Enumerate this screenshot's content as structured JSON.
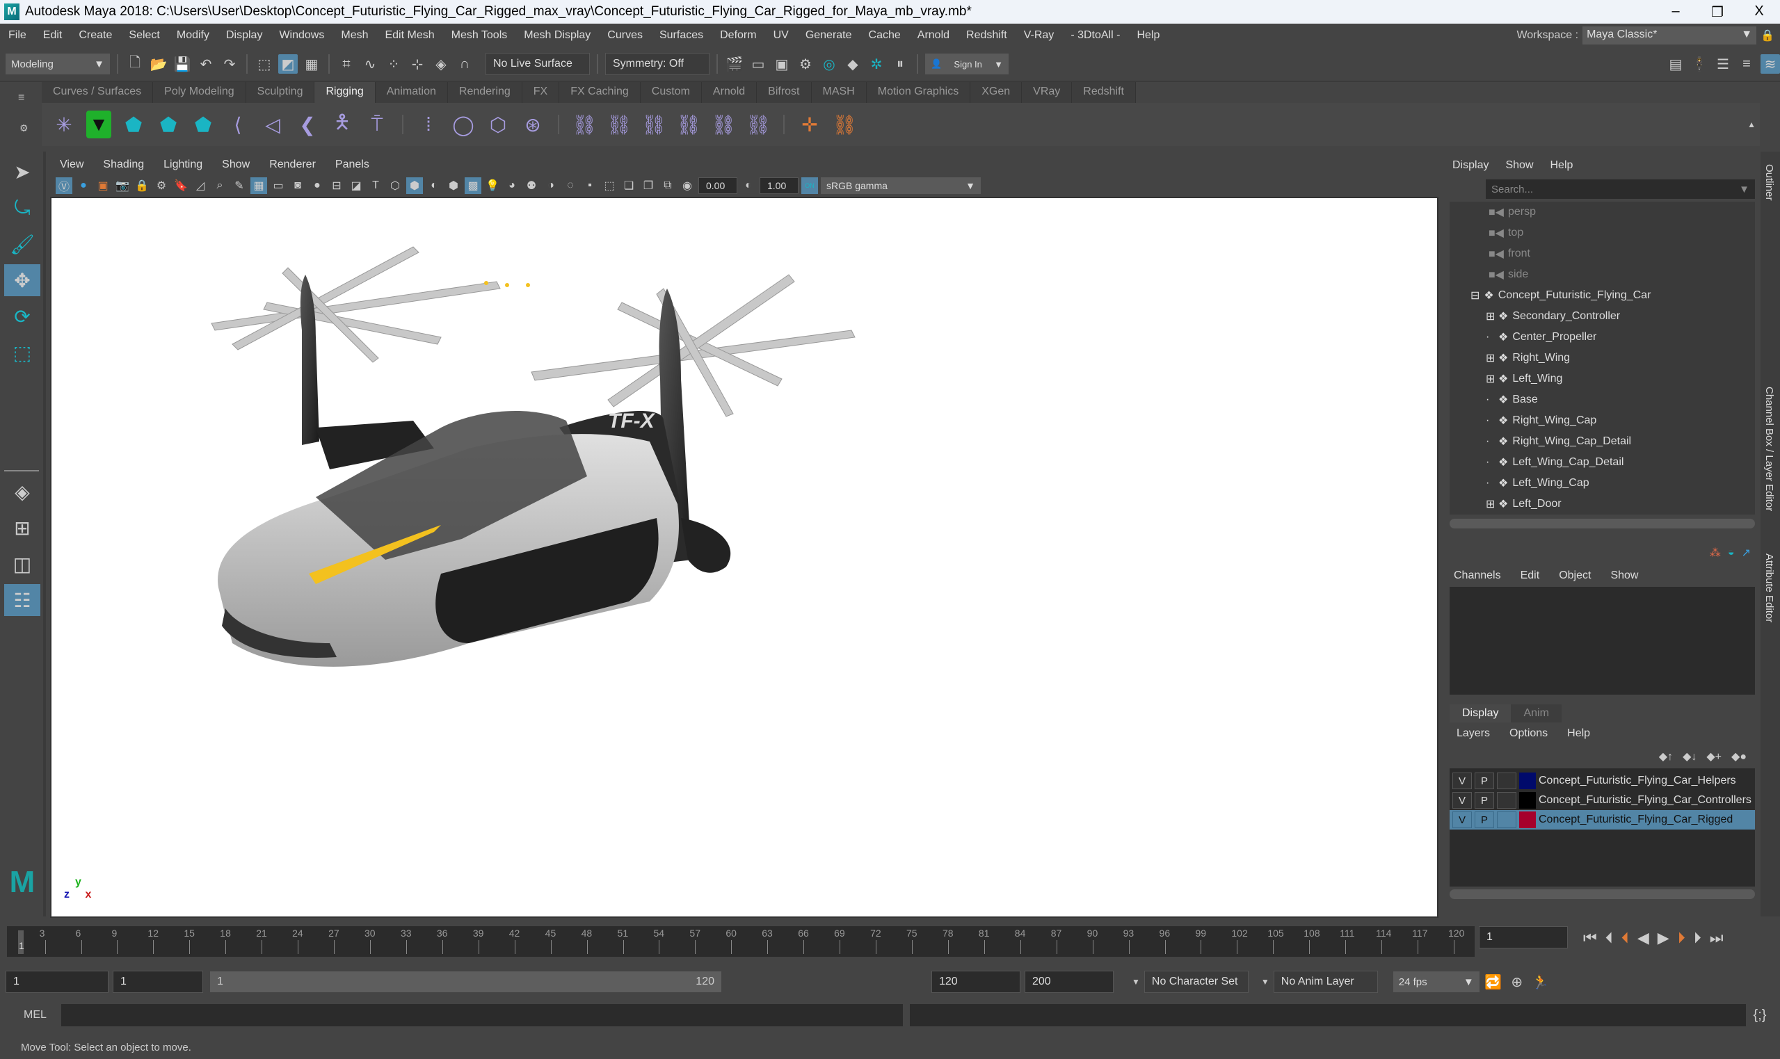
{
  "window": {
    "title": "Autodesk Maya 2018: C:\\Users\\User\\Desktop\\Concept_Futuristic_Flying_Car_Rigged_max_vray\\Concept_Futuristic_Flying_Car_Rigged_for_Maya_mb_vray.mb*",
    "minimize": "–",
    "restore": "❐",
    "close": "X"
  },
  "menubar": [
    "File",
    "Edit",
    "Create",
    "Select",
    "Modify",
    "Display",
    "Windows",
    "Mesh",
    "Edit Mesh",
    "Mesh Tools",
    "Mesh Display",
    "Curves",
    "Surfaces",
    "Deform",
    "UV",
    "Generate",
    "Cache",
    "Arnold",
    "Redshift",
    "V-Ray",
    "- 3DtoAll -",
    "Help"
  ],
  "workspace": {
    "label": "Workspace :",
    "value": "Maya Classic*"
  },
  "statusline": {
    "menuset": "Modeling",
    "live_surface": "No Live Surface",
    "symmetry": "Symmetry: Off",
    "sign_in": "Sign In"
  },
  "shelf": {
    "tabs": [
      "Curves / Surfaces",
      "Poly Modeling",
      "Sculpting",
      "Rigging",
      "Animation",
      "Rendering",
      "FX",
      "FX Caching",
      "Custom",
      "Arnold",
      "Bifrost",
      "MASH",
      "Motion Graphics",
      "XGen",
      "VRay",
      "Redshift"
    ],
    "active_tab": "Rigging"
  },
  "panel": {
    "menu": [
      "View",
      "Shading",
      "Lighting",
      "Show",
      "Renderer",
      "Panels"
    ],
    "exposure": "0.00",
    "gamma": "1.00",
    "color_mgmt_on": "ON",
    "view_transform": "sRGB gamma"
  },
  "viewport": {
    "axis": {
      "x": "x",
      "y": "y",
      "z": "z"
    },
    "decal_text": "TF-X"
  },
  "outliner": {
    "menu": [
      "Display",
      "Show",
      "Help"
    ],
    "search_placeholder": "Search...",
    "cameras": [
      "persp",
      "top",
      "front",
      "side"
    ],
    "root": "Concept_Futuristic_Flying_Car",
    "children": [
      {
        "name": "Secondary_Controller",
        "expandable": true
      },
      {
        "name": "Center_Propeller",
        "expandable": false
      },
      {
        "name": "Right_Wing",
        "expandable": true
      },
      {
        "name": "Left_Wing",
        "expandable": true
      },
      {
        "name": "Base",
        "expandable": false
      },
      {
        "name": "Right_Wing_Cap",
        "expandable": false
      },
      {
        "name": "Right_Wing_Cap_Detail",
        "expandable": false
      },
      {
        "name": "Left_Wing_Cap_Detail",
        "expandable": false
      },
      {
        "name": "Left_Wing_Cap",
        "expandable": false
      },
      {
        "name": "Left_Door",
        "expandable": true
      }
    ]
  },
  "side_tabs": [
    "Outliner",
    "Channel Box / Layer Editor",
    "Attribute Editor"
  ],
  "channelbox": {
    "menu": [
      "Channels",
      "Edit",
      "Object",
      "Show"
    ]
  },
  "layer_editor": {
    "tabs": [
      "Display",
      "Anim"
    ],
    "menu": [
      "Layers",
      "Options",
      "Help"
    ],
    "layers": [
      {
        "v": "V",
        "p": "P",
        "color": "#000a6b",
        "name": "Concept_Futuristic_Flying_Car_Helpers",
        "selected": false
      },
      {
        "v": "V",
        "p": "P",
        "color": "#000000",
        "name": "Concept_Futuristic_Flying_Car_Controllers",
        "selected": false
      },
      {
        "v": "V",
        "p": "P",
        "color": "#a5002c",
        "name": "Concept_Futuristic_Flying_Car_Rigged",
        "selected": true
      }
    ]
  },
  "timeline": {
    "ticks": [
      3,
      6,
      9,
      12,
      15,
      18,
      21,
      24,
      27,
      30,
      33,
      36,
      39,
      42,
      45,
      48,
      51,
      54,
      57,
      60,
      63,
      66,
      69,
      72,
      75,
      78,
      81,
      84,
      87,
      90,
      93,
      96,
      99,
      102,
      105,
      108,
      111,
      114,
      117,
      120
    ],
    "start": 1,
    "end": 120,
    "current_frame": "1"
  },
  "range": {
    "start": "1",
    "playback_start": "1",
    "slider_start": "1",
    "slider_end": "120",
    "playback_end": "120",
    "end": "200",
    "character_set": "No Character Set",
    "anim_layer": "No Anim Layer",
    "fps": "24 fps"
  },
  "command_line": {
    "label": "MEL"
  },
  "status_message": "Move Tool: Select an object to move."
}
